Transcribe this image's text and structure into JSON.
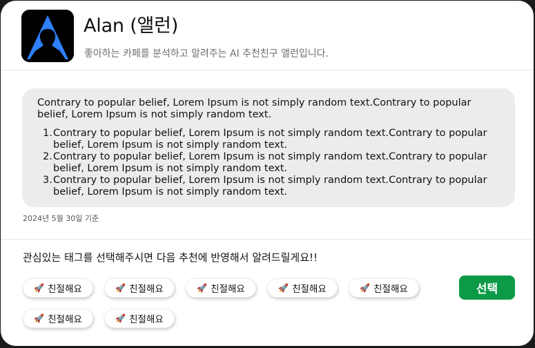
{
  "header": {
    "avatar_icon": "person-silhouette-A-logo-icon",
    "title": "Alan (앨런)",
    "subtitle": "좋아하는 카페를 분석하고 알려주는 AI 추천친구 앨런입니다."
  },
  "message": {
    "intro": "Contrary to popular belief, Lorem Ipsum is not simply random text.Contrary to popular belief, Lorem Ipsum is not simply random text.",
    "items": [
      {
        "num": "1.",
        "text": "Contrary to popular belief, Lorem Ipsum is not simply random text.Contrary to popular belief, Lorem Ipsum is not simply random text."
      },
      {
        "num": "2.",
        "text": "Contrary to popular belief, Lorem Ipsum is not simply random text.Contrary to popular belief, Lorem Ipsum is not simply random text."
      },
      {
        "num": "3.",
        "text": "Contrary to popular belief, Lorem Ipsum is not simply random text.Contrary to popular belief, Lorem Ipsum is not simply random text."
      }
    ],
    "timestamp": "2024년 5월 30일 기준"
  },
  "tags": {
    "prompt": "관심있는 태그를 선택해주시면 다음 추천에 반영해서 알려드릴게요!!",
    "tag_icon": "rocket-icon",
    "items": [
      {
        "label": "친절해요"
      },
      {
        "label": "친절해요"
      },
      {
        "label": "친절해요"
      },
      {
        "label": "친절해요"
      },
      {
        "label": "친절해요"
      },
      {
        "label": "친절해요"
      },
      {
        "label": "친절해요"
      }
    ],
    "select_label": "선택"
  },
  "colors": {
    "accent": "#0c9a47",
    "avatar_blue": "#2f80ff",
    "bubble_bg": "#ececec"
  }
}
